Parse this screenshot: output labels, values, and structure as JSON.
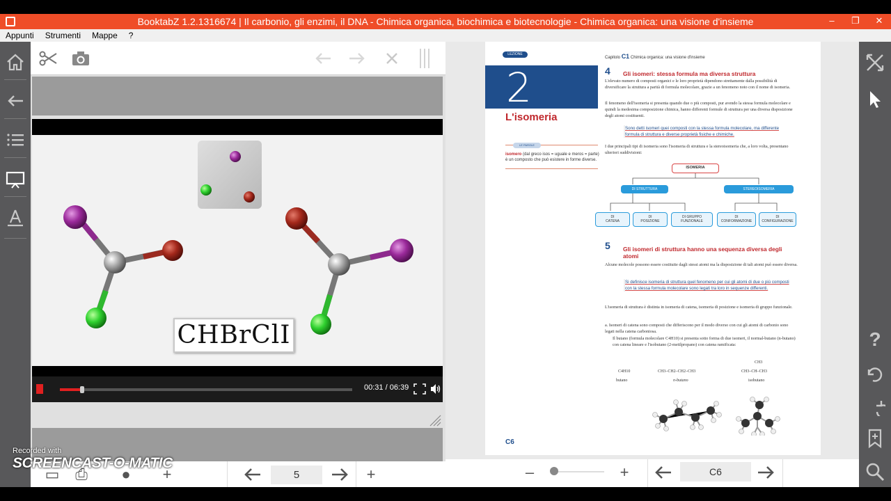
{
  "window": {
    "title": "BooktabZ 1.2.1316674 | Il carbonio, gli enzimi, il DNA - Chimica organica, biochimica e biotecnologie - Chimica organica: una visione d'insieme",
    "controls": {
      "minimize": "–",
      "restore": "❐",
      "close": "✕"
    }
  },
  "menu": [
    "Appunti",
    "Strumenti",
    "Mappe",
    "?"
  ],
  "left_sidebar": {
    "icons": [
      "home-icon",
      "back-arrow-icon",
      "list-icon",
      "whiteboard-icon",
      "tools-icon"
    ]
  },
  "right_sidebar": {
    "icons": [
      "collapse-icon",
      "pointer-icon",
      "help-icon",
      "undo-icon",
      "redo-icon",
      "bookmark-add-icon",
      "search-icon"
    ],
    "help_glyph": "?"
  },
  "left_panel": {
    "toolbar_icons": [
      "scissors-icon",
      "camera-icon",
      "prev-arrow-icon",
      "next-arrow-icon",
      "close-icon",
      "split-icon"
    ],
    "video": {
      "formula": "CHBrClI",
      "time": "00:31 / 06:39",
      "progress": 0.077
    },
    "nav": {
      "minus": "–",
      "plus": "+",
      "page": "5"
    }
  },
  "book_page": {
    "lezione_label": "LEZIONE",
    "lezione_number": "2",
    "lezione_title": "L'isomeria",
    "chapter_label": "Capitolo",
    "chapter_code": "C1",
    "chapter_title": "Chimica organica: una visione d'insieme",
    "parole_label": "LE PAROLE",
    "glossary_term": "isomero",
    "glossary_text": "(dal greco isos = uguale e meros = parte) è un composto che può esistere in forme diverse.",
    "section4_number": "4",
    "section4_title": "Gli isomeri: stessa formula ma diversa struttura",
    "section4_p1": "L'elevato numero di composti organici e le loro proprietà dipendono strettamente dalla possibilità di diversificare la struttura a parità di formula molecolare, grazie a un fenomeno noto con il nome di isomeria.",
    "section4_p2": "Il fenomeno dell'isomeria si presenta quando due o più composti, pur avendo la stessa formula molecolare e quindi la medesima composizione chimica, hanno differenti formule di struttura per una diversa disposizione degli atomi costituenti.",
    "section4_def": "Sono detti isomeri quei composti con la stessa formula molecolare, ma differente formula di struttura e diverse proprietà fisiche e chimiche.",
    "section4_p3": "I due principali tipi di isomeria sono l'isomeria di struttura e la stereoisomeria che, a loro volta, presentano ulteriori suddivisioni:",
    "diagram": {
      "root": "ISOMERIA",
      "branch1": "DI STRUTTURA",
      "branch2": "STEREOISOMERIA",
      "leaves": [
        [
          "DI",
          "CATENA"
        ],
        [
          "DI",
          "POSIZIONE"
        ],
        [
          "DI GRUPPO",
          "FUNZIONALE"
        ],
        [
          "DI",
          "CONFORMAZIONE"
        ],
        [
          "DI",
          "CONFIGURAZIONE"
        ]
      ]
    },
    "section5_number": "5",
    "section5_title": "Gli isomeri di struttura hanno una sequenza diversa degli atomi",
    "section5_p1": "Alcune molecole possono essere costituite dagli stessi atomi ma la disposizione di tali atomi può essere diversa.",
    "section5_def": "Si definisce isomeria di struttura quel fenomeno per cui gli atomi di due o più composti con la stessa formula molecolare sono legati tra loro in sequenze differenti.",
    "section5_p2": "L'isomeria di struttura è distinta in isomeria di catena, isomeria di posizione e isomeria di gruppo funzionale.",
    "item_a": "a. Isomeri di catena sono composti che differiscono per il modo diverso con cui gli atomi di carbonio sono legati nella catena carboniosa.",
    "item_a2": "Il butano (formula molecolare C4H10) si presenta sotto forma di due isomeri, il normal-butano (n-butano) con catena lineare e l'isobutano (2-metilpropano) con catena ramificata:",
    "formulas": [
      {
        "formula": "C4H10",
        "name": "butano"
      },
      {
        "formula": "CH3–CH2–CH2–CH3",
        "name": "n-butano"
      },
      {
        "formula": "CH3–CH–CH3",
        "top": "CH3",
        "name": "isobutano"
      }
    ],
    "page_label": "C6"
  },
  "right_nav": {
    "minus": "–",
    "plus": "+",
    "page": "C6"
  },
  "watermark": {
    "recorded": "Recorded with",
    "brand": "SCREENCAST-O-MATIC"
  }
}
